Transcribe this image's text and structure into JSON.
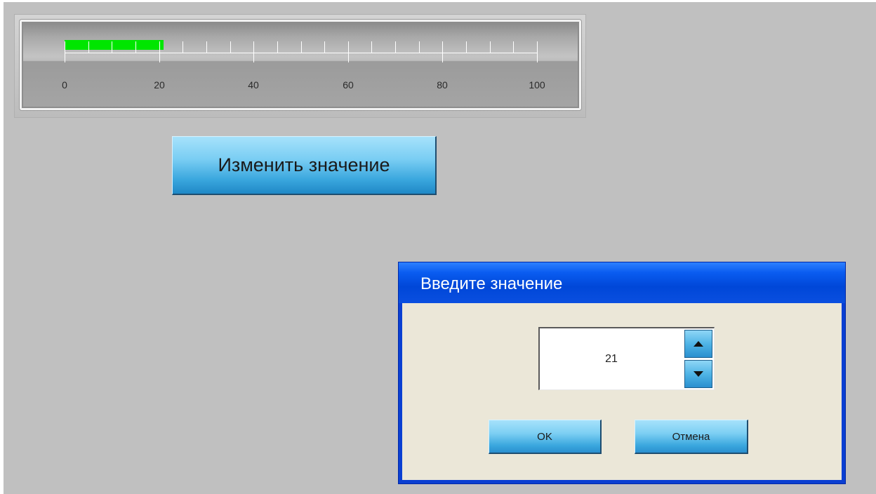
{
  "gauge": {
    "min": 0,
    "max": 100,
    "value": 21,
    "tick_labels": [
      "0",
      "20",
      "40",
      "60",
      "80",
      "100"
    ],
    "fill_color": "#00e600"
  },
  "change_button": {
    "label": "Изменить значение"
  },
  "dialog": {
    "title": "Введите значение",
    "spinner_value": "21",
    "ok_label": "OK",
    "cancel_label": "Отмена",
    "spin_up_icon": "triangle-up-icon",
    "spin_down_icon": "triangle-down-icon"
  }
}
